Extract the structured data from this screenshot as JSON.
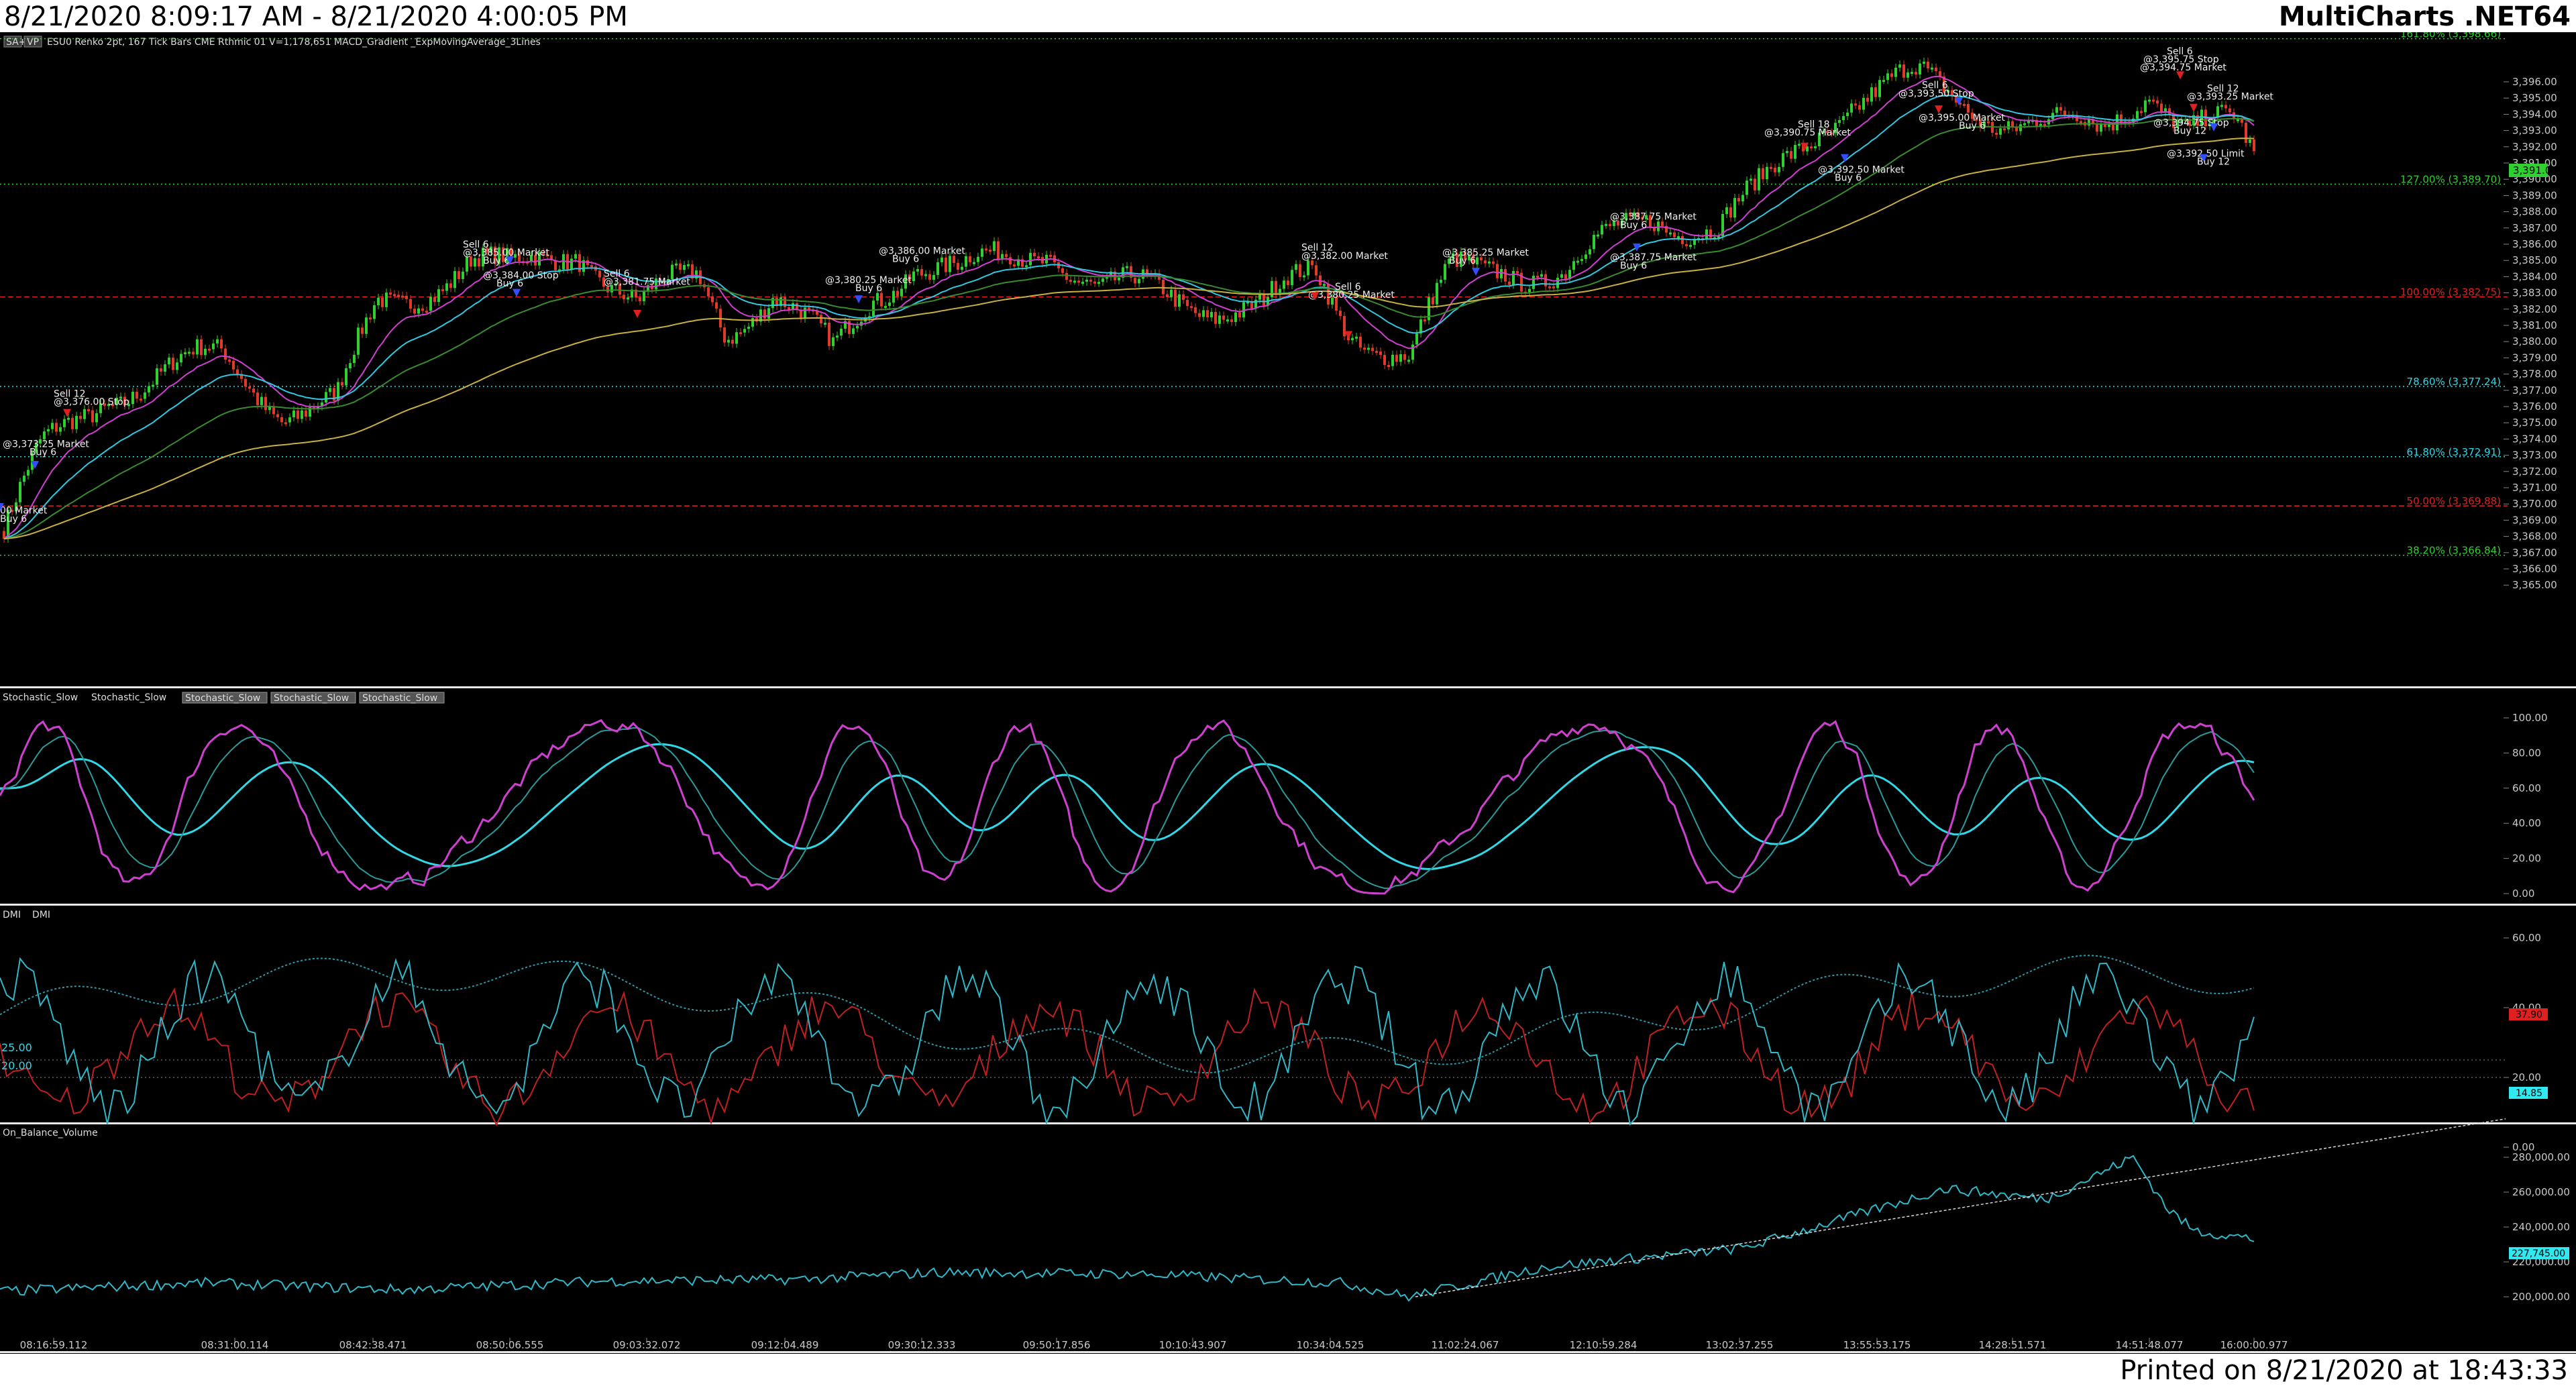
{
  "header": {
    "range": "8/21/2020 8:09:17 AM - 8/21/2020 4:00:05 PM",
    "brand": "MultiCharts .NET64"
  },
  "footer": {
    "printed": "Printed on 8/21/2020 at 18:43:33"
  },
  "colors": {
    "green": "#2fd02f",
    "red": "#e02020",
    "cyan": "#30d8e8",
    "magenta": "#d040d0",
    "blue": "#3050ff"
  },
  "pane1": {
    "toolbar_badges": [
      "SA+",
      "VP"
    ],
    "info": "ESU0  Renko 2pt, 167 Tick Bars  CME  Rthmic 01  V=1,178,651  MACD_Gradient  _ExpMovingAverage_3Lines",
    "price_ticks": [
      "3,396.00",
      "3,395.00",
      "3,394.00",
      "3,393.00",
      "3,392.00",
      "3,391.00",
      "3,390.00",
      "3,389.00",
      "3,388.00",
      "3,387.00",
      "3,386.00",
      "3,385.00",
      "3,384.00",
      "3,383.00",
      "3,382.00",
      "3,381.00",
      "3,380.00",
      "3,379.00",
      "3,378.00",
      "3,377.00",
      "3,376.00",
      "3,375.00",
      "3,374.00",
      "3,373.00",
      "3,372.00",
      "3,371.00",
      "3,370.00",
      "3,369.00",
      "3,368.00",
      "3,367.00",
      "3,366.00",
      "3,365.00"
    ],
    "fib_levels": [
      {
        "label": "161.80% (3,398.66)",
        "color": "#2fd02f"
      },
      {
        "label": "127.00% (3,389.70)",
        "color": "#2fd02f"
      },
      {
        "label": "100.00% (3,382.75)",
        "color": "#e02020"
      },
      {
        "label": "78.60% (3,377.24)",
        "color": "#30d8e8"
      },
      {
        "label": "61.80% (3,372.91)",
        "color": "#30d8e8"
      },
      {
        "label": "50.00% (3,369.88)",
        "color": "#e02020"
      },
      {
        "label": "38.20% (3,366.84)",
        "color": "#2fd02f"
      }
    ],
    "last_price": "3,391.00",
    "trades": [
      "Sell 12",
      "@3,376.00 Stop",
      "@3,373.25 Market",
      "Buy 6",
      "00 Market",
      "Buy 6",
      "Sell 6",
      "@3,385.00 Market",
      "Buy 6",
      "@3,384.00 Stop",
      "Buy 6",
      "Sell 6",
      "@3,381.75 Market",
      "@3,386.00 Market",
      "Buy 6",
      "@3,380.25 Market",
      "Buy 6",
      "Sell 12",
      "@3,382.00 Market",
      "Sell 6",
      "@3,380.25 Market",
      "@3,385.25 Market",
      "Buy 6",
      "@3,387.75 Market",
      "Buy 6",
      "@3,387.75 Market",
      "Buy 6",
      "Sell 18",
      "@3,390.75 Market",
      "@3,392.50 Market",
      "Buy 6",
      "Sell 6",
      "@3,393.50 Stop",
      "@3,395.00 Market",
      "Buy 6",
      "Sell 6",
      "@3,395.75 Stop",
      "@3,394.75 Market",
      "Sell 12",
      "@3,393.25 Market",
      "@3,394.75 Stop",
      "Buy 12",
      "@3,392.50 Limit",
      "Buy 12"
    ]
  },
  "pane2": {
    "legend": [
      "Stochastic_Slow",
      "Stochastic_Slow"
    ],
    "badges": [
      "Stochastic_Slow",
      "Stochastic_Slow",
      "Stochastic_Slow"
    ],
    "ticks": [
      "100.00",
      "80.00",
      "60.00",
      "40.00",
      "20.00",
      "0.00"
    ]
  },
  "pane3": {
    "legend": [
      "DMI",
      "DMI"
    ],
    "ticks": [
      "60.00",
      "40.00",
      "20.00",
      "0.00"
    ],
    "left_levels": [
      "25.00",
      "20.00"
    ],
    "value_red": "37.90",
    "value_cyan": "14.85"
  },
  "pane4": {
    "legend": [
      "On_Balance_Volume"
    ],
    "ticks": [
      "280,000.00",
      "260,000.00",
      "240,000.00",
      "220,000.00",
      "200,000.00"
    ],
    "last_value": "227,745.00"
  },
  "time_axis": [
    "08:16:59.112",
    "08:31:00.114",
    "08:42:38.471",
    "08:50:06.555",
    "09:03:32.072",
    "09:12:04.489",
    "09:30:12.333",
    "09:50:17.856",
    "10:10:43.907",
    "10:34:04.525",
    "11:02:24.067",
    "12:10:59.284",
    "13:02:37.255",
    "13:55:53.175",
    "14:28:51.571",
    "14:51:48.077",
    "16:00:00.977"
  ]
}
